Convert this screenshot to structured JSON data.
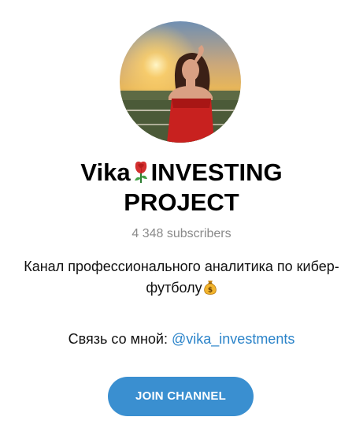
{
  "channel": {
    "title_line1_prefix": "Vika",
    "title_line1_suffix": "INVESTING",
    "title_line2": "PROJECT",
    "title_emoji": "rose-emoji",
    "subscribers": "4 348 subscribers",
    "description_line1": "Канал профессионального аналитика по кибер-",
    "description_line2": "футболу",
    "description_emoji": "money-bag-emoji",
    "contact_label": "Связь со мной:",
    "contact_link": "@vika_investments"
  },
  "join_button": {
    "label": "JOIN CHANNEL"
  },
  "colors": {
    "accent": "#3a8fd0",
    "link": "#2a83c9",
    "muted": "#8a8a8a"
  }
}
